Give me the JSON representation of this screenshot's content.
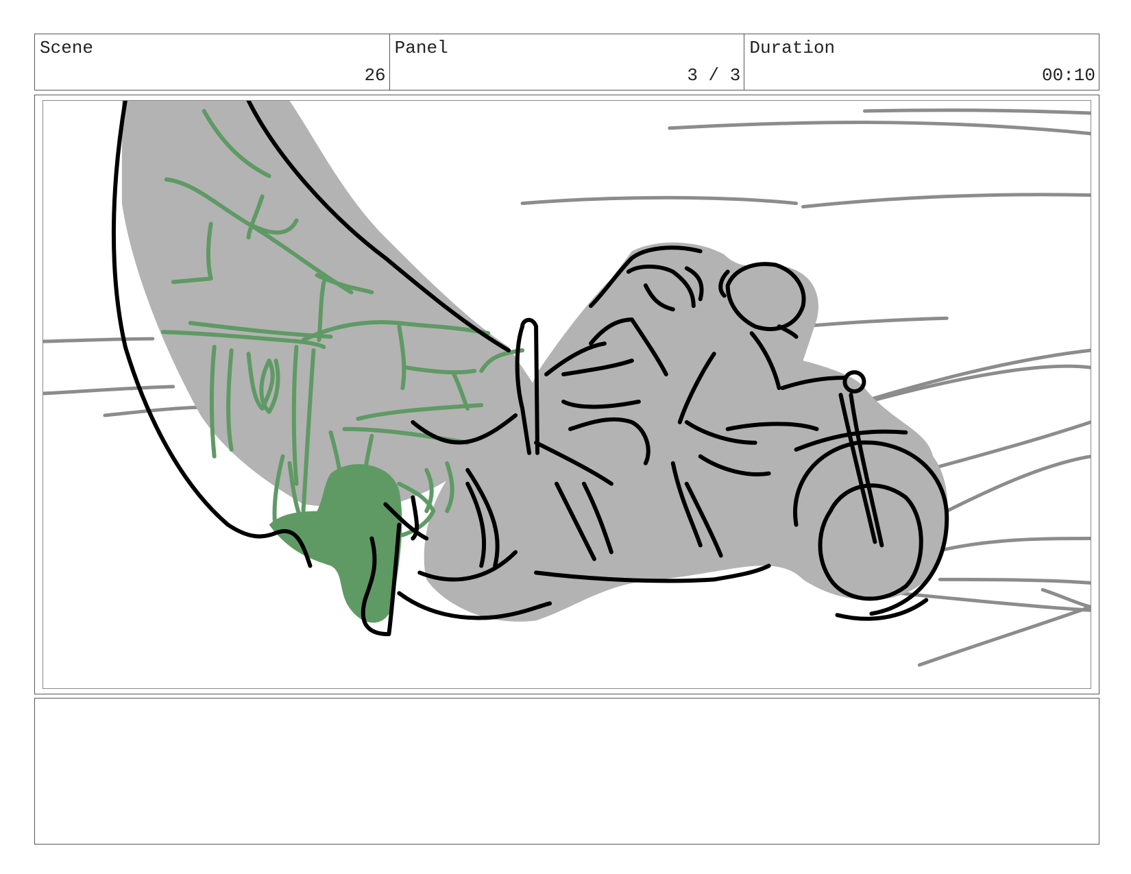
{
  "header": {
    "scene_label": "Scene",
    "scene_value": "26",
    "panel_label": "Panel",
    "panel_value": "3 / 3",
    "duration_label": "Duration",
    "duration_value": "00:10"
  },
  "colors": {
    "ink": "#000000",
    "fill_gray": "#b3b3b3",
    "speed_lines": "#8c8c8c",
    "green": "#5f9a64"
  },
  "notes": {
    "text": ""
  }
}
